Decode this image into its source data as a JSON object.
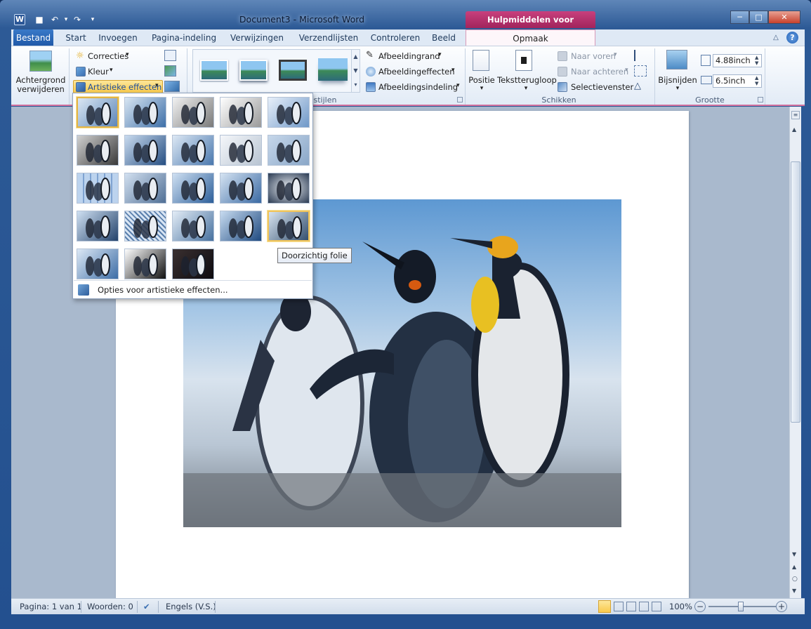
{
  "window": {
    "title": "Document3 - Microsoft Word",
    "context_tab_title": "Hulpmiddelen voor afbeeldingen",
    "minimize": "─",
    "maximize": "□",
    "close": "✕"
  },
  "qat": {
    "logo": "W",
    "save": "■",
    "undo": "↶",
    "redo": "↷",
    "customize": "▾"
  },
  "tabs": [
    "Bestand",
    "Start",
    "Invoegen",
    "Pagina-indeling",
    "Verwijzingen",
    "Verzendlijsten",
    "Controleren",
    "Beeld"
  ],
  "context_tab": "Opmaak",
  "ribbon": {
    "achtergrond": [
      "Achtergrond",
      "verwijderen"
    ],
    "aanpassen": {
      "correcties": "Correcties",
      "kleur": "Kleur",
      "artistieke": "Artistieke effecten"
    },
    "stijlen_label": "dingstijlen",
    "afbeeldingrand": "Afbeeldingrand",
    "afbeeldingeffecten": "Afbeeldingeffecten",
    "afbeeldingsindeling": "Afbeeldingsindeling",
    "positie": "Positie",
    "tekstterugloop": "Tekstterugloop",
    "naar_voren": "Naar voren",
    "naar_achteren": "Naar achteren",
    "selectievenster": "Selectievenster",
    "schikken_label": "Schikken",
    "bijsnijden": "Bijsnijden",
    "hoogte": "4.88inch",
    "breedte": "6.5inch",
    "grootte_label": "Grootte",
    "dropdown_arrow": "▾"
  },
  "gallery": {
    "options_label": "Opties voor artistieke effecten...",
    "tooltip": "Doorzichtig folie"
  },
  "status": {
    "page": "Pagina: 1 van 1",
    "words": "Woorden: 0",
    "language": "Engels (V.S.)",
    "zoom": "100%",
    "zoom_minus": "−",
    "zoom_plus": "+"
  },
  "colors": {
    "accent": "#2b5797",
    "context": "#c8407d",
    "selection": "#e3b445"
  }
}
